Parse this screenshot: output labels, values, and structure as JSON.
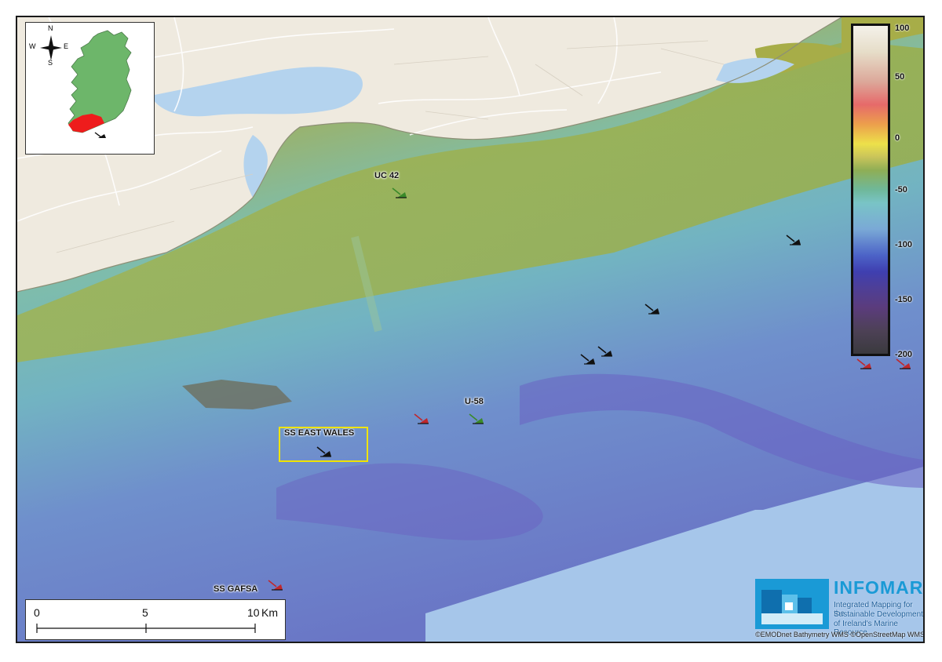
{
  "wrecks": [
    {
      "name": "UC 42",
      "status": "green"
    },
    {
      "name": "U-58",
      "status": "green"
    },
    {
      "name": "SS EAST WALES",
      "status": "black",
      "highlighted": true
    },
    {
      "name": "SS GAFSA",
      "status": "red"
    },
    {
      "name": "",
      "status": "black"
    },
    {
      "name": "",
      "status": "black"
    },
    {
      "name": "",
      "status": "black"
    },
    {
      "name": "",
      "status": "black"
    },
    {
      "name": "",
      "status": "red"
    },
    {
      "name": "",
      "status": "red"
    },
    {
      "name": "",
      "status": "red"
    }
  ],
  "legend": {
    "ticks": [
      "100",
      "50",
      "0",
      "-50",
      "-100",
      "-150",
      "-200"
    ]
  },
  "compass": {
    "n": "N",
    "s": "S",
    "e": "E",
    "w": "W"
  },
  "scalebar": {
    "labels": [
      "0",
      "5",
      "10"
    ],
    "unit": "Km"
  },
  "logo": {
    "title": "INFOMAR",
    "tagline": [
      "Integrated Mapping for the",
      "Sustainable Development",
      "of Ireland's Marine Resource"
    ]
  },
  "attribution": "©EMODnet Bathymetry WMS ©OpenStreetMap WMS",
  "colors": {
    "wreck_black": "#111111",
    "wreck_green": "#3a8a2a",
    "wreck_red": "#c0282d",
    "highlight": "#f0e400",
    "ireland_land": "#6db66a",
    "study_area": "#ee1c1c"
  }
}
